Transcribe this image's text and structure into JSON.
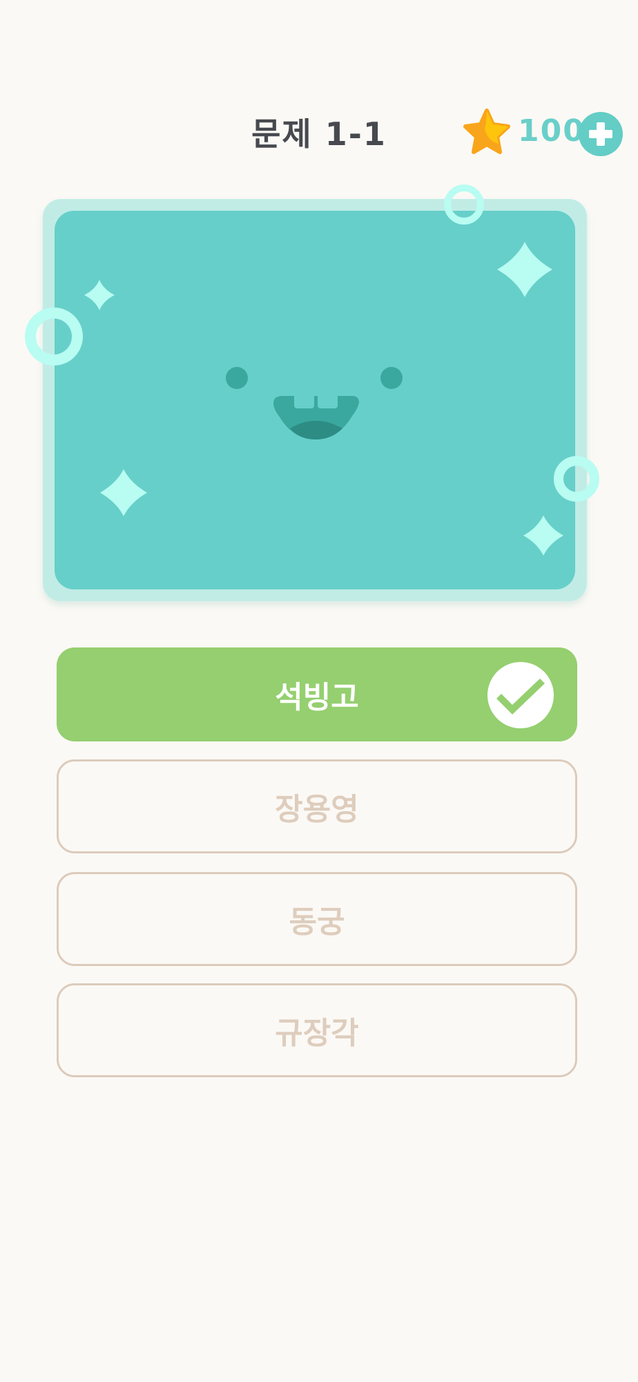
{
  "header": {
    "title": "문제 1-1"
  },
  "wallet": {
    "coins": "100",
    "star_icon": "star-icon",
    "add_icon": "plus-icon",
    "accent": "#63cdc6"
  },
  "quiz": {
    "picture": {
      "card_color": "#67cfc9",
      "frame_color": "#c1ece6"
    },
    "answers": [
      {
        "label": "석빙고",
        "state": "correct"
      },
      {
        "label": "장용영",
        "state": "unselected"
      },
      {
        "label": "동궁",
        "state": "unselected"
      },
      {
        "label": "규장각",
        "state": "unselected"
      }
    ],
    "correct_color": "#95cf6f"
  }
}
